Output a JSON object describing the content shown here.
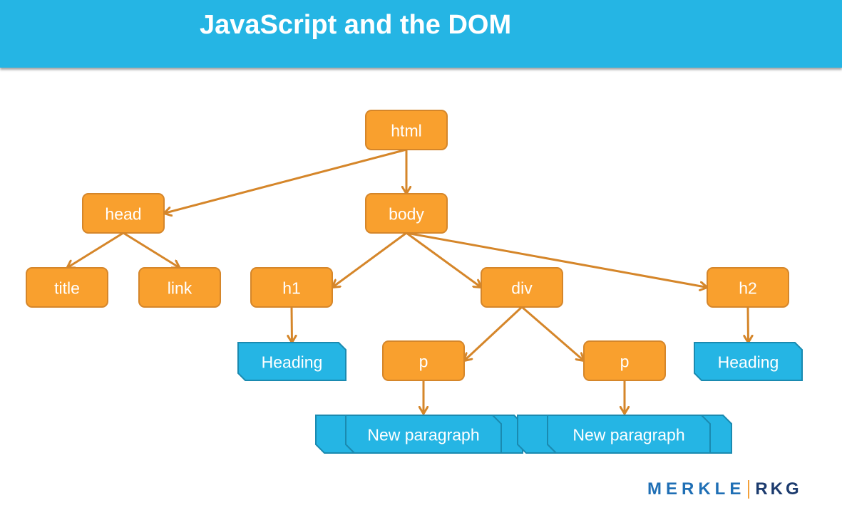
{
  "slide": {
    "title": "JavaScript and the DOM"
  },
  "colors": {
    "banner": "#25b5e4",
    "element_fill": "#f9a02e",
    "element_border": "#d5862a",
    "text_node_fill": "#25b5e4",
    "text_node_border": "#1a8ab0",
    "arrow": "#d5862a"
  },
  "tree": {
    "element_nodes": [
      {
        "id": "html",
        "label": "html"
      },
      {
        "id": "head",
        "label": "head"
      },
      {
        "id": "body",
        "label": "body"
      },
      {
        "id": "title",
        "label": "title"
      },
      {
        "id": "link",
        "label": "link"
      },
      {
        "id": "h1",
        "label": "h1"
      },
      {
        "id": "div",
        "label": "div"
      },
      {
        "id": "h2",
        "label": "h2"
      },
      {
        "id": "p1",
        "label": "p"
      },
      {
        "id": "p2",
        "label": "p"
      }
    ],
    "text_nodes": [
      {
        "id": "t_h1",
        "label": "Heading"
      },
      {
        "id": "t_h2",
        "label": "Heading"
      },
      {
        "id": "t_p1",
        "label": "New paragraph"
      },
      {
        "id": "t_p2",
        "label": "New paragraph"
      }
    ],
    "edges": [
      [
        "html",
        "head"
      ],
      [
        "html",
        "body"
      ],
      [
        "head",
        "title"
      ],
      [
        "head",
        "link"
      ],
      [
        "body",
        "h1"
      ],
      [
        "body",
        "div"
      ],
      [
        "body",
        "h2"
      ],
      [
        "h1",
        "t_h1"
      ],
      [
        "h2",
        "t_h2"
      ],
      [
        "div",
        "p1"
      ],
      [
        "div",
        "p2"
      ],
      [
        "p1",
        "t_p1"
      ],
      [
        "p2",
        "t_p2"
      ]
    ]
  },
  "logo": {
    "left": "MERKLE",
    "right": "RKG"
  }
}
